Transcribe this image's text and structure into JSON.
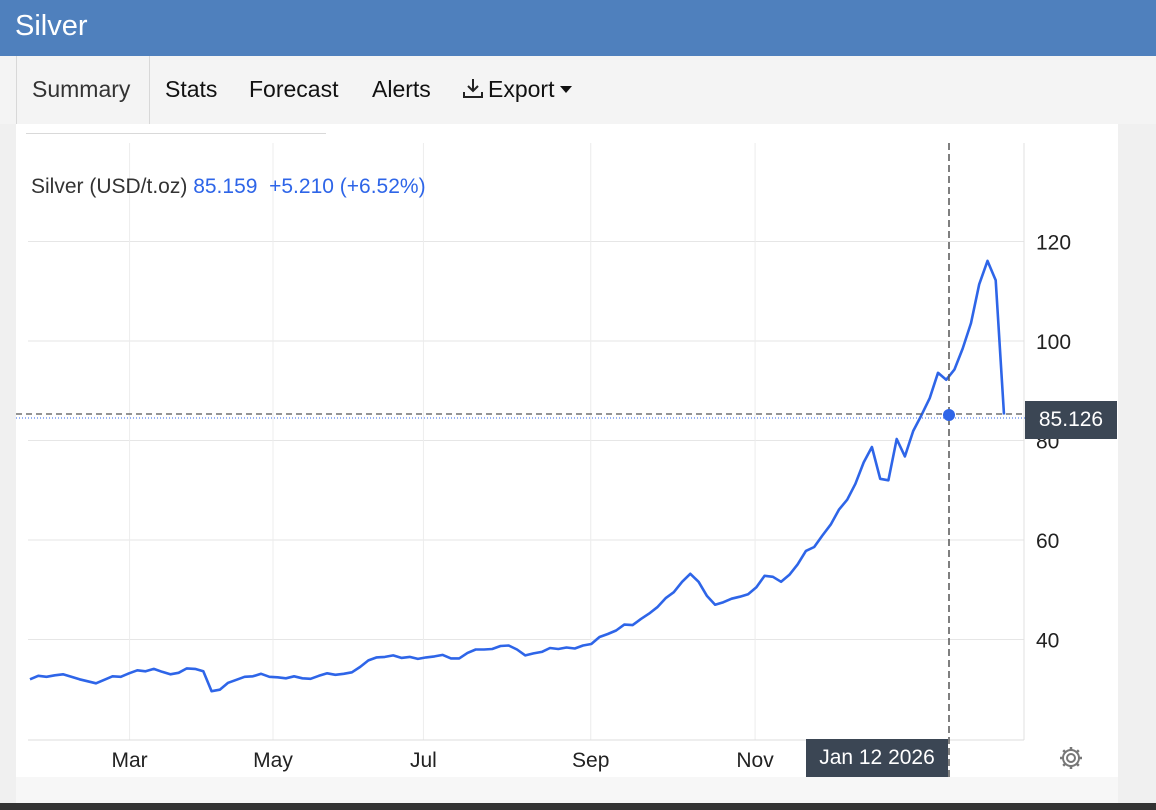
{
  "header": {
    "title": "Silver"
  },
  "tabs": [
    {
      "label": "Summary"
    },
    {
      "label": "Stats"
    },
    {
      "label": "Forecast"
    },
    {
      "label": "Alerts"
    },
    {
      "label": "Export"
    }
  ],
  "legend": {
    "name": "Silver (USD/t.oz)",
    "price": "85.159",
    "change": "+5.210",
    "change_pct": "(+6.52%)"
  },
  "crosshair": {
    "price": "85.126",
    "date": "Jan 12 2026"
  },
  "colors": {
    "header": "#4f80bd",
    "line": "#2e65e8",
    "label_bg": "#3b4654"
  },
  "icons": {
    "export": "download-icon",
    "settings": "gear-icon"
  },
  "chart_data": {
    "type": "line",
    "ylim": [
      20,
      140
    ],
    "yticks": [
      40,
      60,
      80,
      100,
      120
    ],
    "xticks": [
      {
        "label": "Mar",
        "t": 0.102
      },
      {
        "label": "May",
        "t": 0.246
      },
      {
        "label": "Jul",
        "t": 0.397
      },
      {
        "label": "Sep",
        "t": 0.565
      },
      {
        "label": "Nov",
        "t": 0.73
      }
    ],
    "grid": true,
    "series": [
      {
        "values": [
          32.0,
          32.7,
          32.5,
          32.8,
          33.0,
          32.5,
          32.0,
          31.6,
          31.2,
          31.9,
          32.6,
          32.5,
          33.2,
          33.8,
          33.6,
          34.1,
          33.5,
          33.0,
          33.3,
          34.2,
          34.1,
          33.6,
          29.6,
          29.9,
          31.3,
          31.9,
          32.5,
          32.6,
          33.1,
          32.5,
          32.4,
          32.2,
          32.6,
          32.2,
          32.1,
          32.7,
          33.2,
          32.9,
          33.1,
          33.4,
          34.5,
          35.8,
          36.4,
          36.5,
          36.8,
          36.3,
          36.5,
          36.1,
          36.4,
          36.6,
          36.9,
          36.2,
          36.2,
          37.3,
          38.0,
          38.0,
          38.1,
          38.7,
          38.8,
          38.0,
          36.8,
          37.2,
          37.5,
          38.3,
          38.1,
          38.4,
          38.2,
          38.8,
          39.1,
          40.5,
          41.1,
          41.8,
          43.0,
          42.9,
          44.1,
          45.2,
          46.5,
          48.3,
          49.5,
          51.6,
          53.2,
          51.6,
          48.8,
          47.0,
          47.5,
          48.2,
          48.6,
          49.1,
          50.5,
          52.8,
          52.6,
          51.6,
          53.0,
          55.1,
          57.8,
          58.6,
          60.9,
          63.1,
          66.1,
          68.1,
          71.3,
          75.6,
          78.7,
          72.3,
          72.0,
          80.3,
          76.8,
          81.9,
          85.1,
          88.5,
          93.6,
          92.2,
          94.3,
          98.5,
          103.6,
          111.4,
          116.1,
          112.2,
          85.2
        ]
      }
    ]
  }
}
